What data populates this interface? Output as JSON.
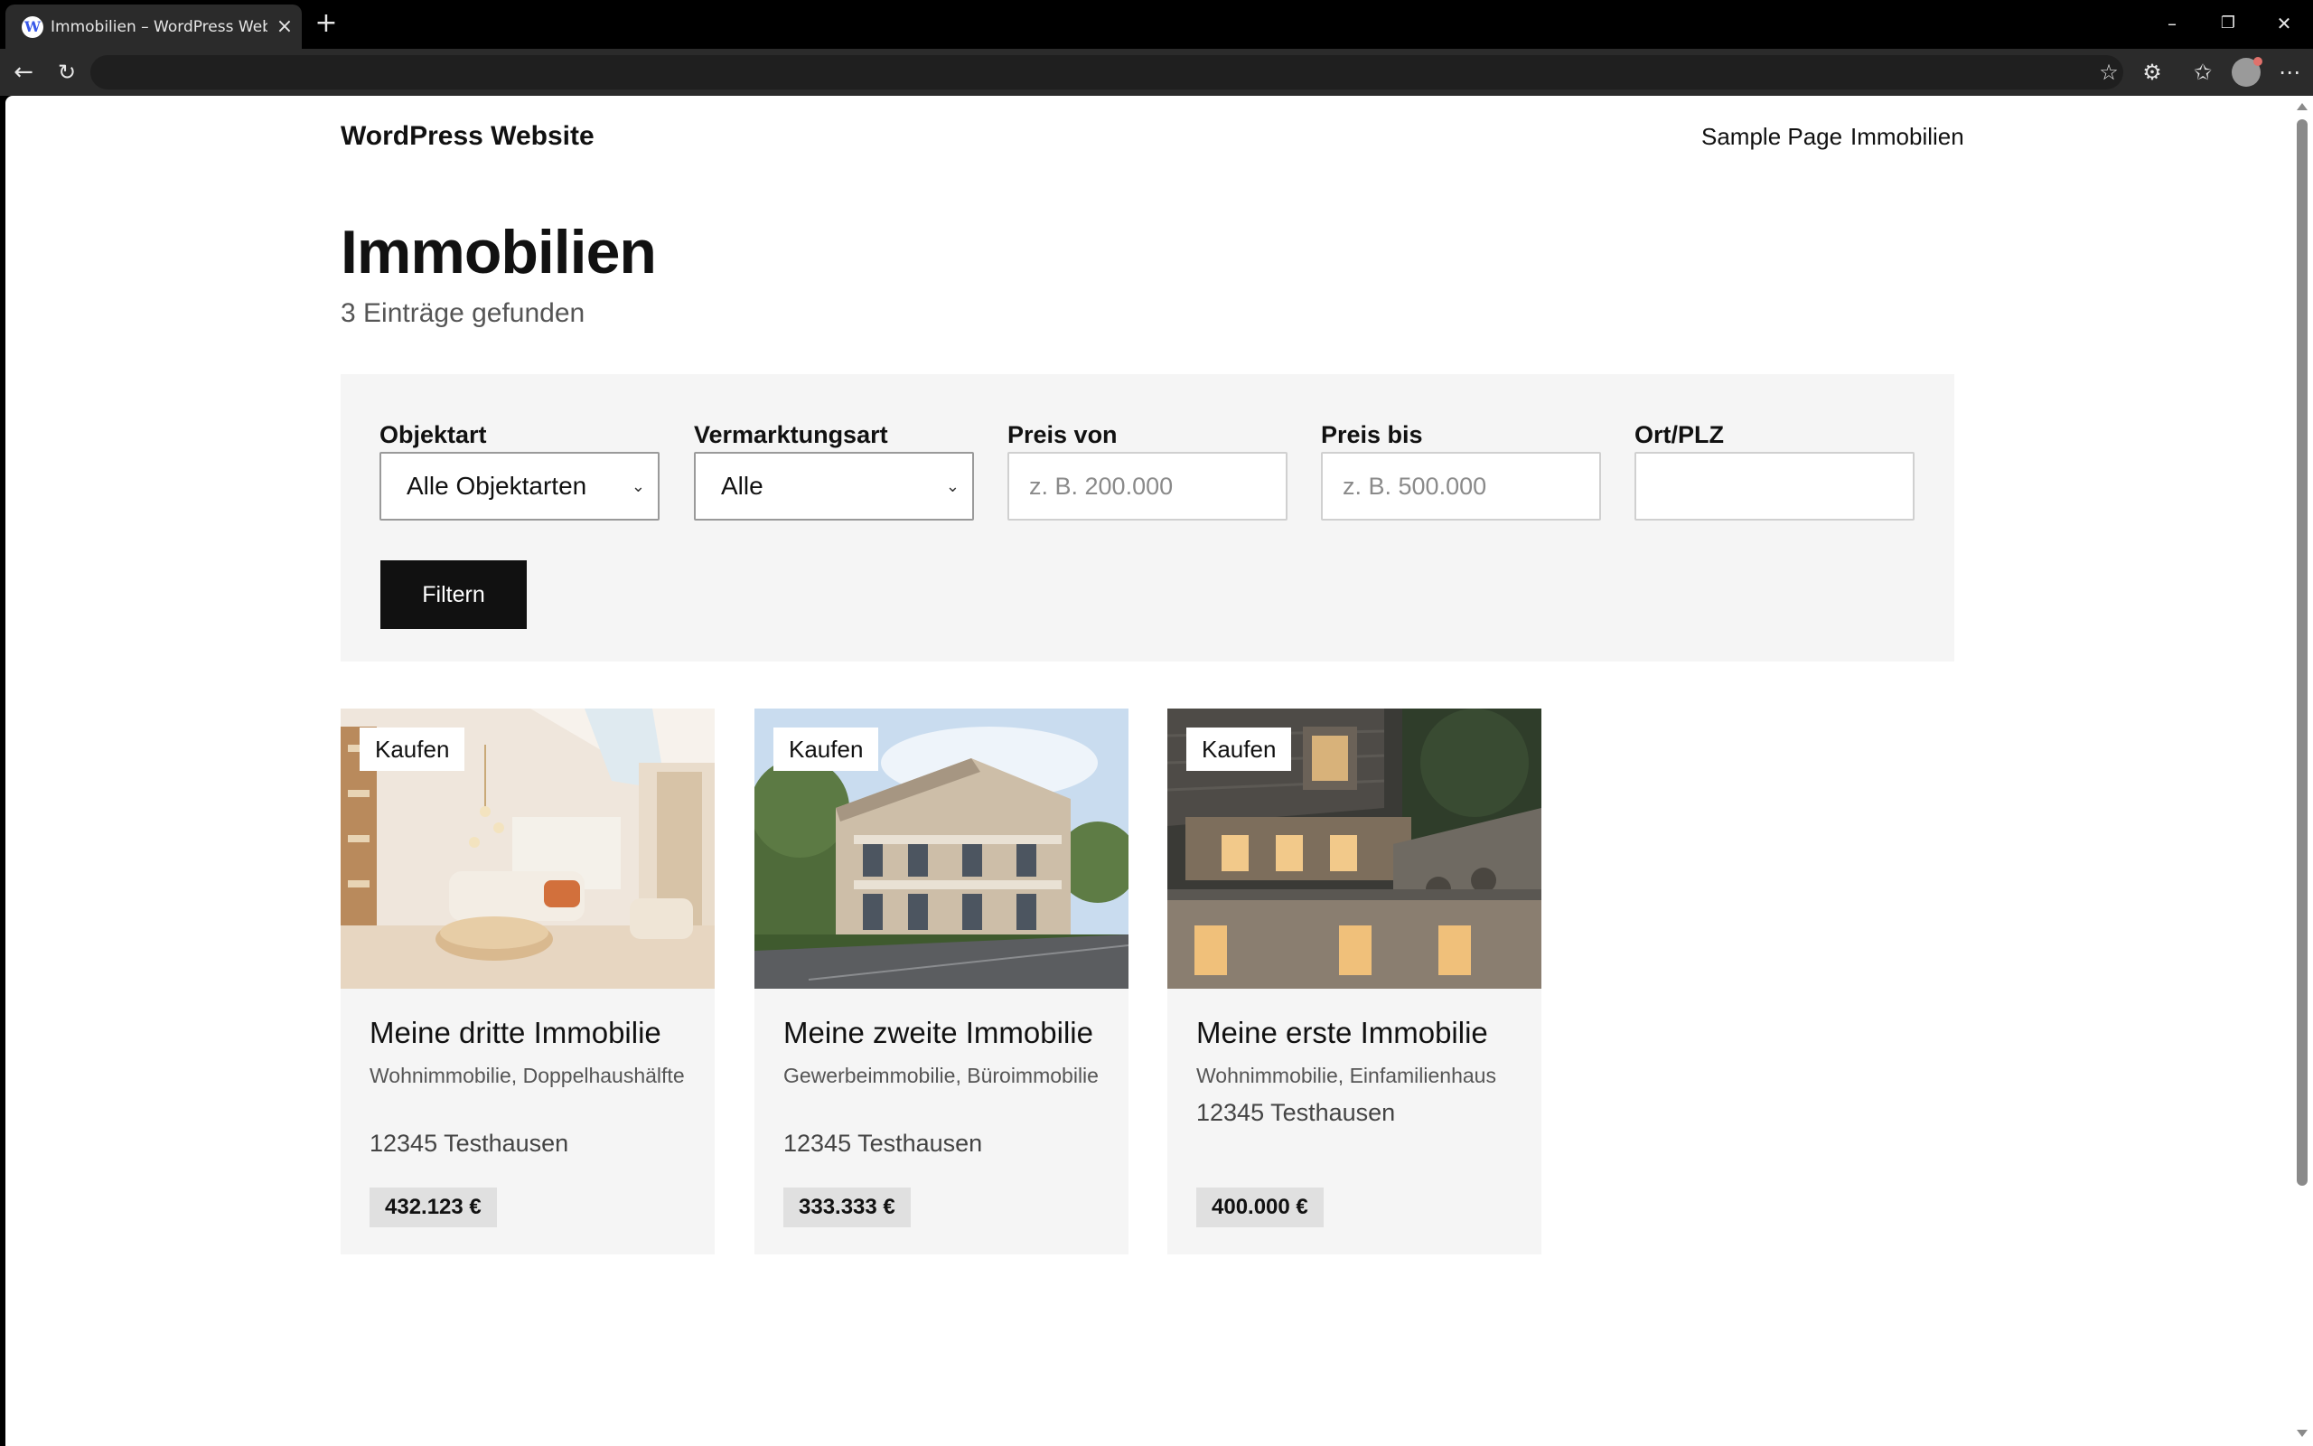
{
  "browser": {
    "tab_title": "Immobilien – WordPress Website"
  },
  "site": {
    "title": "WordPress Website",
    "nav": [
      "Sample Page",
      "Immobilien"
    ]
  },
  "page": {
    "heading": "Immobilien",
    "result_count": "3 Einträge gefunden"
  },
  "filters": {
    "objektart": {
      "label": "Objektart",
      "value": "Alle Objektarten"
    },
    "vermarktungsart": {
      "label": "Vermarktungsart",
      "value": "Alle"
    },
    "preis_von": {
      "label": "Preis von",
      "placeholder": "z. B. 200.000"
    },
    "preis_bis": {
      "label": "Preis bis",
      "placeholder": "z. B. 500.000"
    },
    "ort": {
      "label": "Ort/PLZ",
      "value": ""
    },
    "submit_label": "Filtern"
  },
  "listings": [
    {
      "badge": "Kaufen",
      "title": "Meine dritte Immobilie",
      "types": "Wohnimmobilie, Doppelhaushälfte",
      "city": "12345 Testhausen",
      "price": "432.123 €"
    },
    {
      "badge": "Kaufen",
      "title": "Meine zweite Immobilie",
      "types": "Gewerbeimmobilie, Büroimmobilie",
      "city": "12345 Testhausen",
      "price": "333.333 €"
    },
    {
      "badge": "Kaufen",
      "title": "Meine erste Immobilie",
      "types": "Wohnimmobilie, Einfamilienhaus",
      "city": "12345 Testhausen",
      "price": "400.000 €"
    }
  ]
}
